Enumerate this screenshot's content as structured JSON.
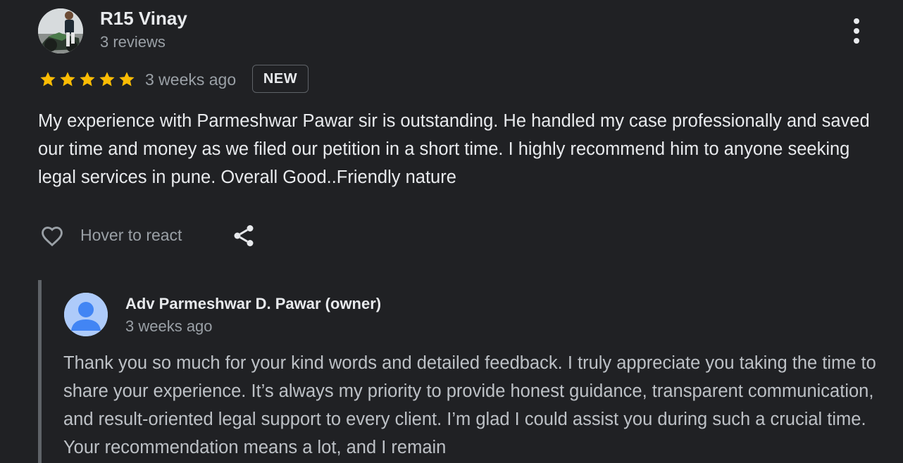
{
  "review": {
    "reviewer_name": "R15 Vinay",
    "review_count": "3 reviews",
    "rating": 5,
    "rating_max": 5,
    "time_ago": "3 weeks ago",
    "badge": "NEW",
    "text": "My experience with Parmeshwar Pawar sir is outstanding. He handled my case professionally and saved our time and money as we filed our petition in a short time. I highly recommend him to anyone seeking legal services in pune. Overall Good..Friendly nature"
  },
  "actions": {
    "react_label": "Hover to react"
  },
  "owner_reply": {
    "name": "Adv Parmeshwar D. Pawar (owner)",
    "time_ago": "3 weeks ago",
    "text": "Thank you so much for your kind words and detailed feedback. I truly appreciate you taking the time to share your experience. It’s always my priority to provide honest guidance, transparent communication, and result-oriented legal support to every client. I’m glad I could assist you during such a crucial time. Your recommendation means a lot, and I remain"
  },
  "icons": {
    "star": "star-icon",
    "more": "more-vert-icon",
    "heart": "heart-outline-icon",
    "share": "share-icon",
    "owner_avatar": "person-icon"
  },
  "colors": {
    "background": "#202124",
    "star": "#fbbc04",
    "text_primary": "#e8eaed",
    "text_secondary": "#9aa0a6",
    "reply_text": "#bdc1c6",
    "owner_avatar_bg": "#aecbfa",
    "owner_avatar_fg": "#4285f4"
  }
}
